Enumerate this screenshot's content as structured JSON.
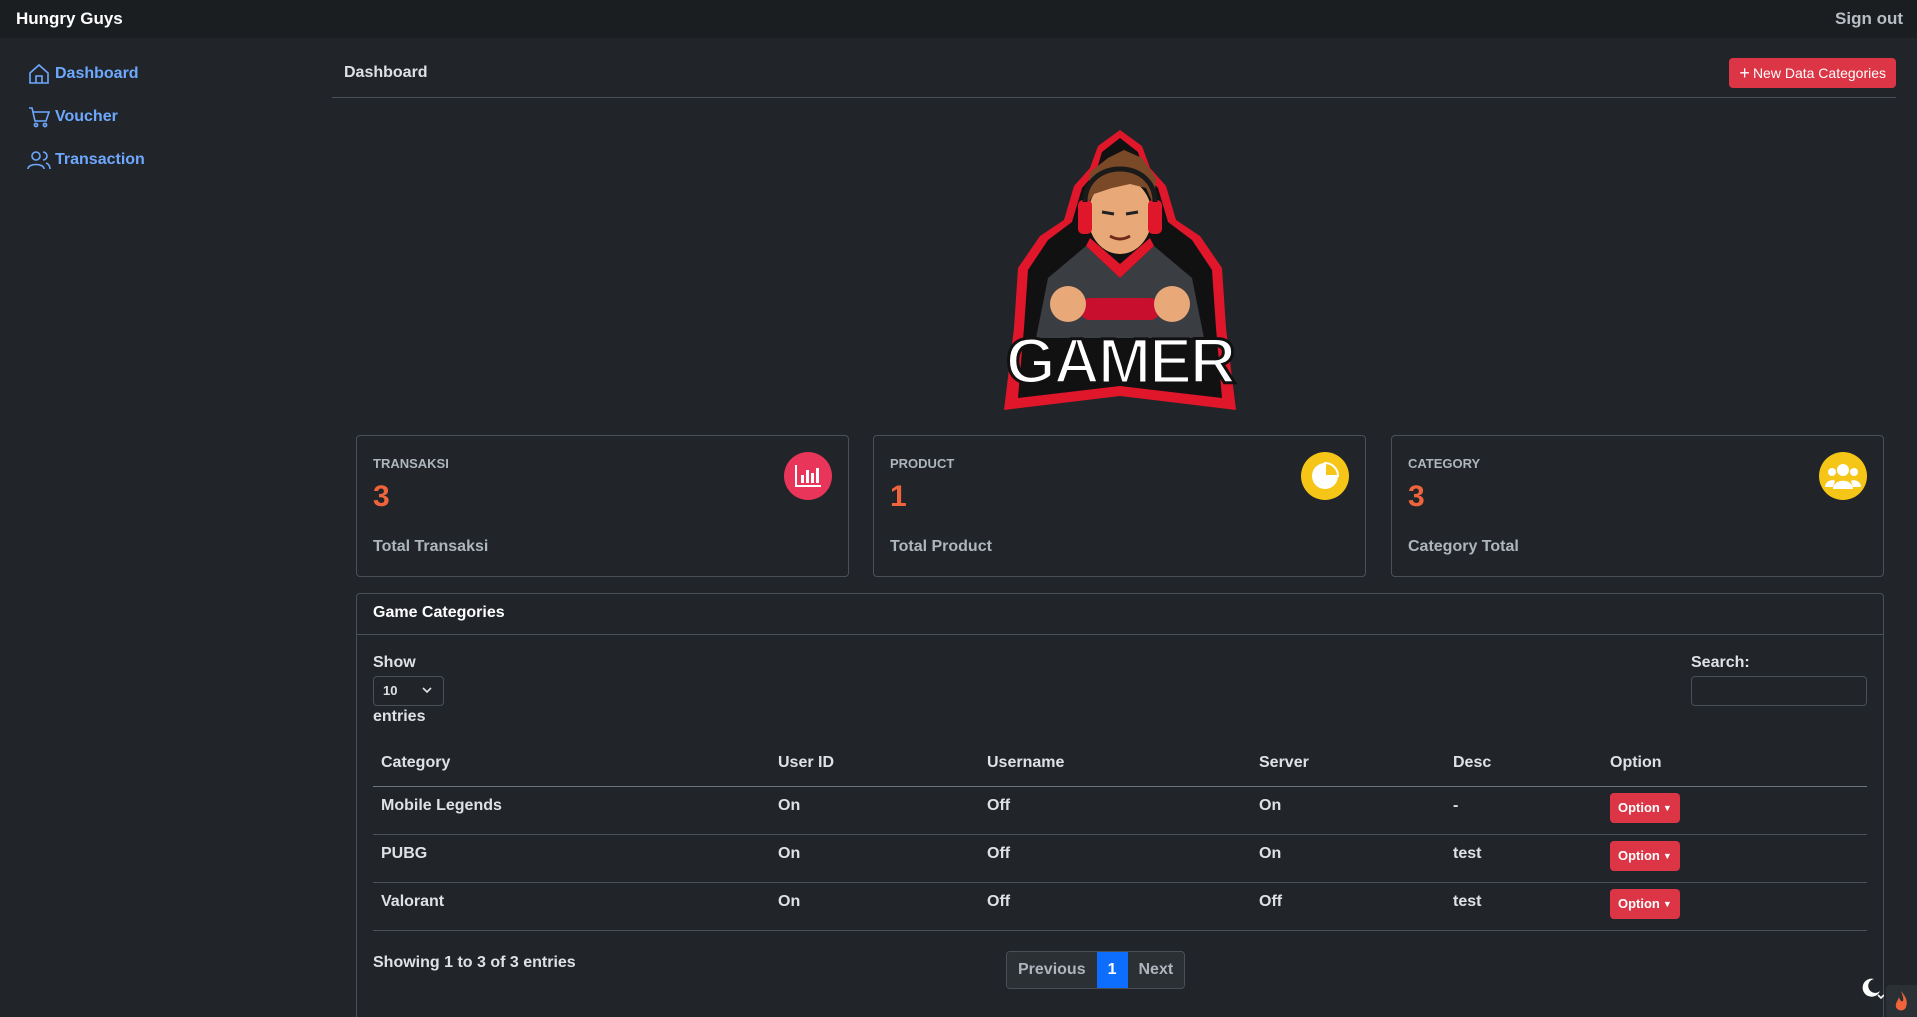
{
  "navbar": {
    "brand": "Hungry Guys",
    "signout": "Sign out"
  },
  "sidebar": {
    "items": [
      {
        "label": "Dashboard",
        "icon": "house-icon"
      },
      {
        "label": "Voucher",
        "icon": "cart-icon"
      },
      {
        "label": "Transaction",
        "icon": "people-icon"
      }
    ]
  },
  "header": {
    "title": "Dashboard",
    "new_button": "New Data Categories"
  },
  "logo": {
    "text": "GAMER"
  },
  "cards": [
    {
      "label": "TRANSAKSI",
      "value": "3",
      "sub": "Total Transaksi",
      "icon": "bar-chart-icon",
      "color": "#e9355a"
    },
    {
      "label": "PRODUCT",
      "value": "1",
      "sub": "Total Product",
      "icon": "pie-chart-icon",
      "color": "#f5c518"
    },
    {
      "label": "CATEGORY",
      "value": "3",
      "sub": "Category Total",
      "icon": "users-icon",
      "color": "#f5c518"
    }
  ],
  "table_card": {
    "title": "Game Categories",
    "show": "Show",
    "length_value": "10",
    "entries": "entries",
    "search_label": "Search:",
    "columns": [
      "Category",
      "User ID",
      "Username",
      "Server",
      "Desc",
      "Option"
    ],
    "rows": [
      [
        "Mobile Legends",
        "On",
        "Off",
        "On",
        "-",
        "Option"
      ],
      [
        "PUBG",
        "On",
        "Off",
        "On",
        "test",
        "Option"
      ],
      [
        "Valorant",
        "On",
        "Off",
        "Off",
        "test",
        "Option"
      ]
    ],
    "info": "Showing 1 to 3 of 3 entries",
    "pagination": {
      "previous": "Previous",
      "current": "1",
      "next": "Next"
    }
  },
  "colors": {
    "accent": "#dc3545",
    "link": "#6ea8fe",
    "stat": "#f0643c",
    "primary": "#0d6efd"
  }
}
